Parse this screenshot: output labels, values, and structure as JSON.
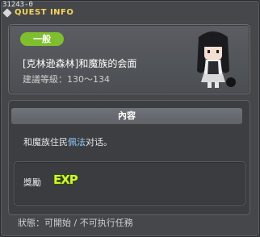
{
  "window": {
    "quest_id": "31243-0",
    "title": "QUEST INFO"
  },
  "quest": {
    "category": "一般",
    "name": "[克林逊森林]和魔族的会面",
    "level_range": "建議等級：130～134"
  },
  "content": {
    "header": "內容",
    "text_prefix": "和魔族住民",
    "text_highlight": "佩法",
    "text_suffix": "对话。"
  },
  "reward": {
    "label": "獎勵",
    "icon": "EXP"
  },
  "status": {
    "text": "狀態：可開始 / 不可执行任務"
  },
  "colors": {
    "title": "#f6d35b",
    "badge": "#7fbf2f",
    "highlight": "#8fd0ff",
    "exp": "#d4f233"
  }
}
